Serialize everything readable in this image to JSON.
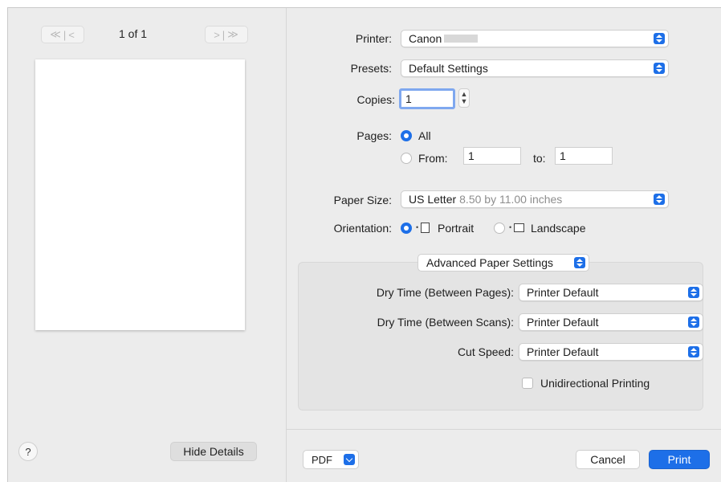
{
  "preview": {
    "first_page_glyph": "≪",
    "prev_page_glyph": "<",
    "next_page_glyph": ">",
    "last_page_glyph": "≫",
    "page_count": "1 of 1",
    "help_label": "?",
    "hide_details_label": "Hide Details"
  },
  "settings": {
    "printer_label": "Printer:",
    "printer_value": "Canon",
    "presets_label": "Presets:",
    "presets_value": "Default Settings",
    "copies_label": "Copies:",
    "copies_value": "1",
    "pages_label": "Pages:",
    "pages_all_label": "All",
    "pages_from_label": "From:",
    "pages_from_value": "1",
    "pages_to_label": "to:",
    "pages_to_value": "1",
    "paper_size_label": "Paper Size:",
    "paper_size_value": "US Letter",
    "paper_size_dims": "8.50 by 11.00 inches",
    "orientation_label": "Orientation:",
    "portrait_label": "Portrait",
    "landscape_label": "Landscape",
    "pages_selected": "All",
    "orientation_selected": "Portrait"
  },
  "advanced": {
    "section_label": "Advanced Paper Settings",
    "dry_pages_label": "Dry Time (Between Pages):",
    "dry_pages_value": "Printer Default",
    "dry_scans_label": "Dry Time (Between Scans):",
    "dry_scans_value": "Printer Default",
    "cut_speed_label": "Cut Speed:",
    "cut_speed_value": "Printer Default",
    "unidirectional_label": "Unidirectional Printing",
    "unidirectional_checked": false
  },
  "footer": {
    "pdf_label": "PDF",
    "cancel_label": "Cancel",
    "print_label": "Print"
  },
  "colors": {
    "accent": "#1d6fe8",
    "background": "#ececec"
  }
}
